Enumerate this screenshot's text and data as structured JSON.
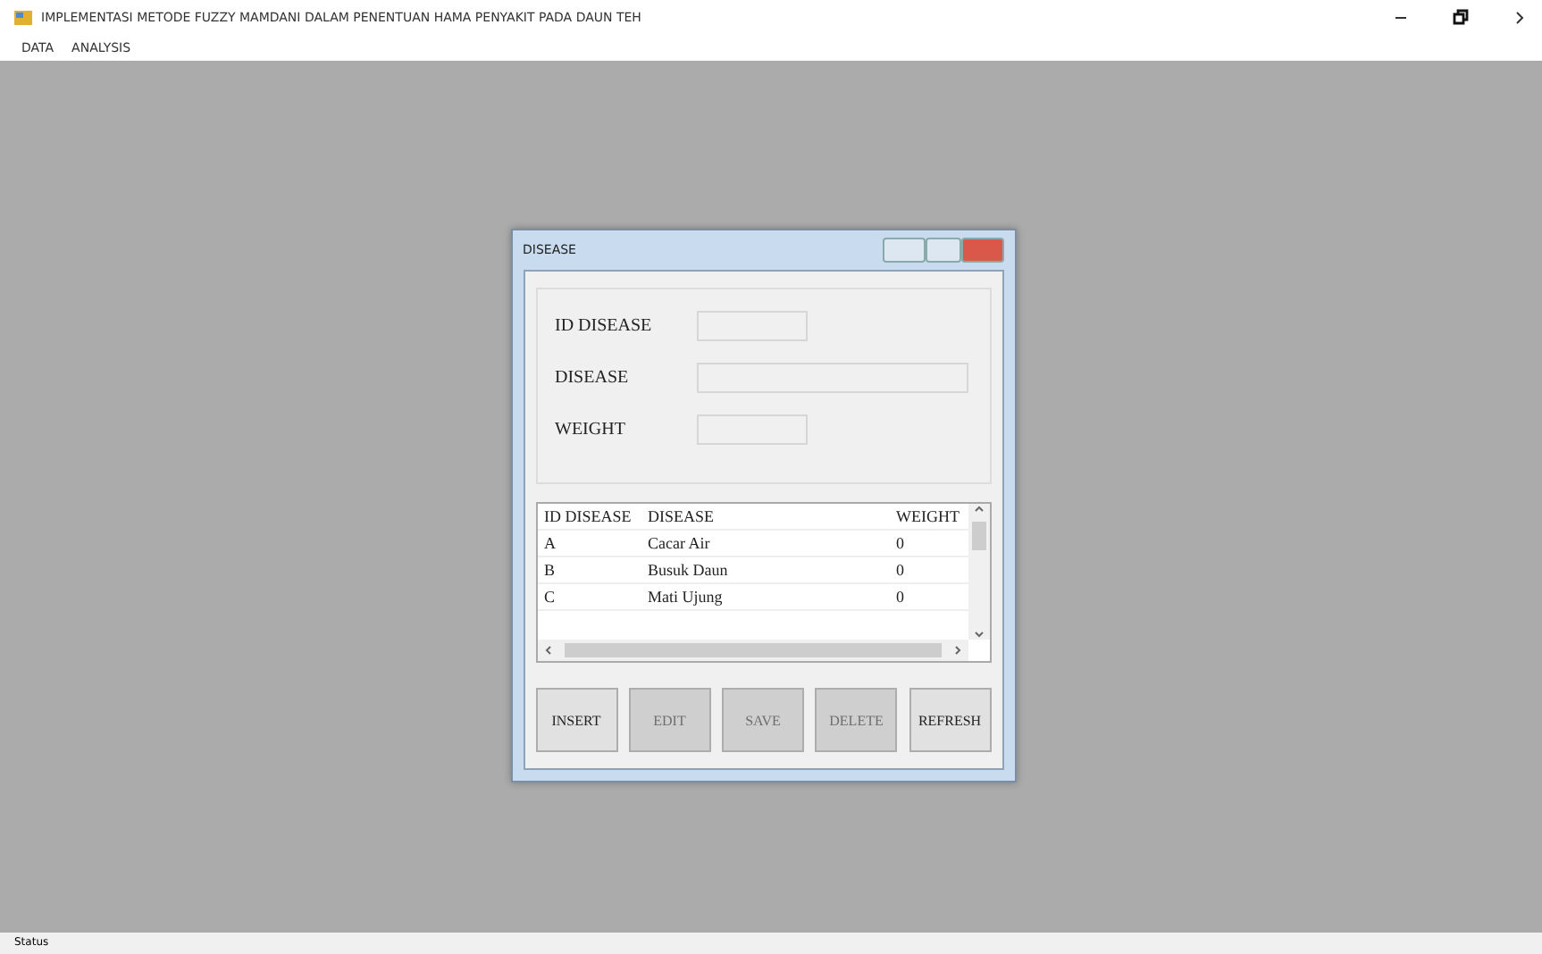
{
  "window": {
    "title": "IMPLEMENTASI METODE FUZZY MAMDANI DALAM PENENTUAN HAMA PENYAKIT PADA DAUN TEH"
  },
  "menu": [
    "DATA",
    "ANALYSIS"
  ],
  "dialog": {
    "title": "DISEASE",
    "fields": [
      {
        "label": "ID DISEASE",
        "kind": "short"
      },
      {
        "label": "DISEASE",
        "kind": "long"
      },
      {
        "label": "WEIGHT",
        "kind": "short"
      }
    ],
    "table": {
      "columns": [
        "ID DISEASE",
        "DISEASE",
        "WEIGHT"
      ],
      "rows": [
        [
          "A",
          "Cacar Air",
          "0"
        ],
        [
          "B",
          "Busuk Daun",
          "0"
        ],
        [
          "C",
          "Mati Ujung",
          "0"
        ]
      ]
    },
    "buttons": [
      {
        "label": "INSERT",
        "disabled": false
      },
      {
        "label": "EDIT",
        "disabled": true
      },
      {
        "label": "SAVE",
        "disabled": true
      },
      {
        "label": "DELETE",
        "disabled": true
      },
      {
        "label": "REFRESH",
        "disabled": false
      }
    ]
  },
  "status_bar": "Status"
}
